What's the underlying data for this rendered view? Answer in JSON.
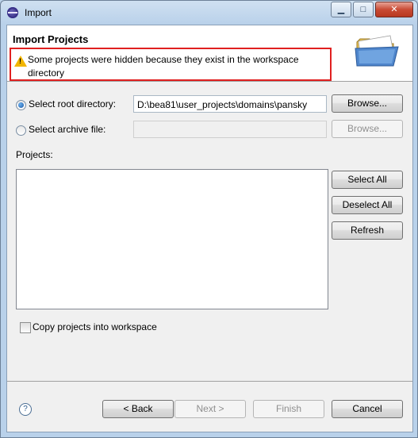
{
  "window": {
    "title": "Import",
    "controls": {
      "minimize": "▁",
      "maximize": "□",
      "close": "✕"
    }
  },
  "banner": {
    "title": "Import Projects",
    "message": "Some projects were hidden because they exist in the workspace directory",
    "icon": "folder-open-icon"
  },
  "source": {
    "root_option_label": "Select root directory:",
    "root_selected": true,
    "root_value": "D:\\bea81\\user_projects\\domains\\pansky",
    "archive_option_label": "Select archive file:",
    "archive_selected": false,
    "archive_value": "",
    "browse_label": "Browse..."
  },
  "projects": {
    "label": "Projects:",
    "items": [],
    "select_all_label": "Select All",
    "deselect_all_label": "Deselect All",
    "refresh_label": "Refresh"
  },
  "options": {
    "copy_label": "Copy projects into workspace",
    "copy_checked": false
  },
  "footer": {
    "help_icon": "?",
    "back_label": "< Back",
    "next_label": "Next >",
    "finish_label": "Finish",
    "cancel_label": "Cancel"
  },
  "colors": {
    "highlight_border": "#e02020",
    "warning": "#f2b600",
    "window_frame": "#b9d1ea"
  }
}
